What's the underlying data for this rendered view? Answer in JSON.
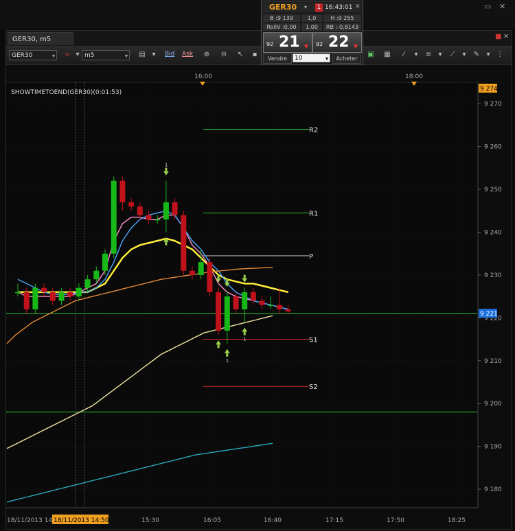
{
  "window": {
    "tab_title": "GER30, m5",
    "controls": [
      "▭",
      "✕"
    ],
    "frame_controls": [
      "✕"
    ]
  },
  "toolbar": {
    "symbol": "GER30",
    "timeframe": "m5",
    "bid_label": "Bid",
    "ask_label": "Ask"
  },
  "price_panel": {
    "symbol": "GER30",
    "badge": "1",
    "time": "16:43:01",
    "bid_cell": "B :9 139",
    "mid_cell": "1,0",
    "high_cell": "H :9 255",
    "rollv_cell": "RollV :0,00",
    "mid2_cell": "1,00",
    "rb_cell": "RB :-0,8143",
    "sell_prefix": "92",
    "sell_big": "21",
    "buy_prefix": "92",
    "buy_big": "22",
    "sell_label": "Vendre",
    "quantity": "10",
    "buy_label": "Acheter"
  },
  "chart_data": {
    "type": "candlestick",
    "indicator_label": "SHOWTIMETOEND(GER30)(0:01:53)",
    "instrument": "GER30",
    "timeframe": "m5",
    "ylim": [
      9176,
      9275
    ],
    "y_ticks": [
      9180,
      9190,
      9200,
      9210,
      9220,
      9230,
      9240,
      9250,
      9260,
      9270
    ],
    "y_tick_labels": [
      "9 180",
      "9 190",
      "9 200",
      "9 210",
      "9 220",
      "9 230",
      "9 240",
      "9 250",
      "9 260",
      "9 270"
    ],
    "top_price_label": "9 274",
    "current_price_label": "9 221",
    "current_price": 9221,
    "x_top_labels": [
      "16:00",
      "18:00"
    ],
    "x_bottom_labels": [
      "18/11/2013 14:",
      "18/11/2013 14:50",
      "15:30",
      "16:05",
      "16:40",
      "17:15",
      "17:50",
      "18:25"
    ],
    "pivot_levels": [
      {
        "name": "R2",
        "value": 9264
      },
      {
        "name": "R1",
        "value": 9244.5
      },
      {
        "name": "P",
        "value": 9234.5
      },
      {
        "name": "S1",
        "value": 9215
      },
      {
        "name": "S2",
        "value": 9204
      }
    ],
    "horizontal_lines": [
      9221,
      9198
    ],
    "candles": [
      [
        9226,
        9228,
        9225,
        9226
      ],
      [
        9226,
        9227,
        9221,
        9222
      ],
      [
        9222,
        9228,
        9221,
        9227
      ],
      [
        9227,
        9228,
        9225,
        9226
      ],
      [
        9226,
        9227,
        9223,
        9224
      ],
      [
        9224,
        9227,
        9223,
        9226
      ],
      [
        9226,
        9227,
        9224,
        9225
      ],
      [
        9225,
        9228,
        9224,
        9227
      ],
      [
        9227,
        9230,
        9226,
        9229
      ],
      [
        9229,
        9232,
        9228,
        9231
      ],
      [
        9231,
        9236,
        9230,
        9235
      ],
      [
        9235,
        9253,
        9234,
        9252
      ],
      [
        9252,
        9253,
        9245,
        9247
      ],
      [
        9247,
        9248,
        9245,
        9246
      ],
      [
        9246,
        9247,
        9243,
        9244
      ],
      [
        9244,
        9245,
        9242,
        9243
      ],
      [
        9243,
        9244,
        9242,
        9243
      ],
      [
        9243,
        9252,
        9240,
        9247
      ],
      [
        9247,
        9248,
        9243,
        9244
      ],
      [
        9244,
        9245,
        9230,
        9231
      ],
      [
        9231,
        9232,
        9229,
        9230
      ],
      [
        9230,
        9236,
        9229,
        9233
      ],
      [
        9233,
        9234,
        9225,
        9226
      ],
      [
        9226,
        9227,
        9216,
        9217
      ],
      [
        9217,
        9226,
        9214,
        9225
      ],
      [
        9225,
        9226,
        9221,
        9222
      ],
      [
        9222,
        9227,
        9219,
        9226
      ],
      [
        9226,
        9227,
        9223,
        9224
      ],
      [
        9224,
        9225,
        9222,
        9223
      ],
      [
        9223,
        9225,
        9222,
        9223
      ],
      [
        9223,
        9227,
        9221,
        9222
      ],
      [
        9222,
        9223,
        9221,
        9221.5
      ]
    ],
    "moving_averages": [
      {
        "color": "#ffef3a",
        "values": [
          9226,
          9226,
          9226,
          9226,
          9226,
          9226,
          9226,
          9226,
          9226,
          9227,
          9228,
          9231,
          9234,
          9236,
          9237,
          9237.5,
          9238,
          9238.5,
          9238,
          9237,
          9236,
          9234,
          9232,
          9230,
          9229,
          9228.5,
          9228,
          9228,
          9227.5,
          9227,
          9226.5,
          9226
        ]
      },
      {
        "color": "#ff8fd0",
        "values": [
          9226,
          9225,
          9225,
          9225,
          9225,
          9225,
          9225,
          9226,
          9227,
          9228,
          9231,
          9238,
          9242,
          9243.5,
          9243.5,
          9243,
          9243,
          9244,
          9244,
          9241,
          9237,
          9235,
          9232,
          9228,
          9226,
          9225,
          9224.5,
          9224,
          9223.5,
          9223,
          9222.5,
          9222
        ]
      },
      {
        "color": "#4aa8ff",
        "values": [
          9229,
          9228,
          9227,
          9226,
          9225.5,
          9225.5,
          9225.5,
          9226,
          9226,
          9227,
          9229,
          9233,
          9238,
          9241,
          9243,
          9244,
          9244.5,
          9245,
          9244,
          9241,
          9238,
          9236,
          9233,
          9231,
          9228,
          9226,
          9225,
          9224,
          9223.5,
          9223,
          9222.5,
          9222
        ]
      },
      {
        "color": "#e78b3a",
        "values": [
          9214,
          9216,
          9217.5,
          9219,
          9220,
          9221,
          9222,
          9223,
          9224,
          9224.5,
          9225,
          9225.5,
          9226,
          9226.5,
          9227,
          9227.5,
          9228,
          9228.5,
          9229,
          9229.3,
          9229.6,
          9229.9,
          9230.2,
          9230.5,
          9230.8,
          9231,
          9231.2,
          9231.4,
          9231.5,
          9231.6,
          9231.7,
          9231.8
        ]
      },
      {
        "color": "#f0e6a0",
        "values": [
          9189.5,
          9190.5,
          9191.5,
          9192.5,
          9193.5,
          9194.5,
          9195.5,
          9196.5,
          9197.5,
          9198.5,
          9199.5,
          9201,
          9202.5,
          9204,
          9205.5,
          9207,
          9208.5,
          9210,
          9211.5,
          9212.5,
          9213.5,
          9214.5,
          9215.5,
          9216.5,
          9217,
          9217.5,
          9218,
          9218.5,
          9219,
          9219.5,
          9220,
          9220.5
        ]
      },
      {
        "color": "#2aa7c0",
        "values": [
          9177,
          9177.5,
          9178,
          9178.5,
          9179,
          9179.5,
          9180,
          9180.5,
          9181,
          9181.5,
          9182,
          9182.5,
          9183,
          9183.5,
          9184,
          9184.5,
          9185,
          9185.5,
          9186,
          9186.5,
          9187,
          9187.5,
          9188,
          9188.3,
          9188.6,
          9188.9,
          9189.2,
          9189.5,
          9189.8,
          9190.1,
          9190.4,
          9190.7
        ]
      }
    ],
    "signals_down": [
      {
        "candle": 17,
        "label": "1"
      },
      {
        "candle": 23
      },
      {
        "candle": 24
      },
      {
        "candle": 26
      }
    ],
    "signals_up": [
      {
        "candle": 17
      },
      {
        "candle": 23
      },
      {
        "candle": 24,
        "label": "1"
      },
      {
        "candle": 26,
        "label": "1"
      }
    ]
  }
}
